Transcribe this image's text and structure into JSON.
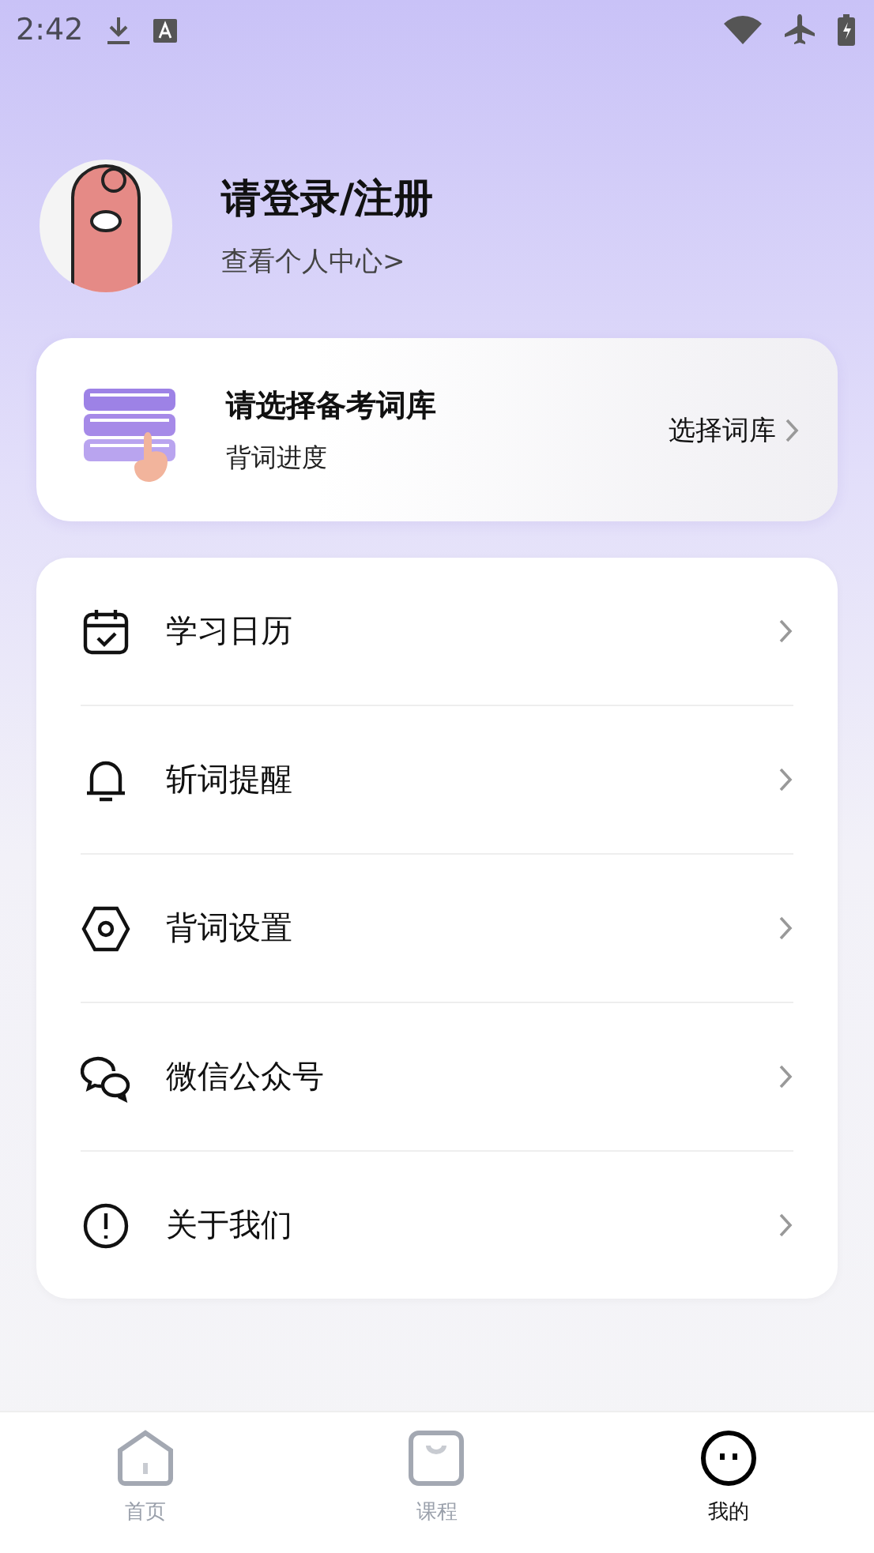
{
  "status_bar": {
    "time": "2:42"
  },
  "profile": {
    "title": "请登录/注册",
    "subtitle": "查看个人中心>"
  },
  "wordbook_card": {
    "title": "请选择备考词库",
    "subtitle": "背词进度",
    "action": "选择词库"
  },
  "menu": [
    {
      "kind": "calendar",
      "label": "学习日历"
    },
    {
      "kind": "bell",
      "label": "斩词提醒"
    },
    {
      "kind": "hexagon",
      "label": "背词设置"
    },
    {
      "kind": "wechat",
      "label": "微信公众号"
    },
    {
      "kind": "info",
      "label": "关于我们"
    }
  ],
  "tabs": [
    {
      "kind": "home",
      "label": "首页",
      "selected": false
    },
    {
      "kind": "bag",
      "label": "课程",
      "selected": false
    },
    {
      "kind": "face",
      "label": "我的",
      "selected": true
    }
  ]
}
